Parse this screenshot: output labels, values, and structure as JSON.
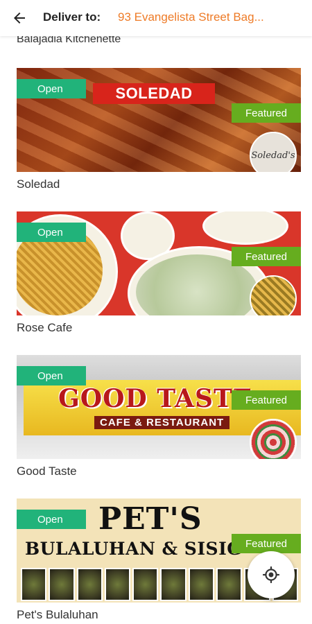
{
  "header": {
    "deliver_label": "Deliver to:",
    "address": "93 Evangelista Street Bag..."
  },
  "partial_item": {
    "name": "Balajadia Kitchenette"
  },
  "restaurants": [
    {
      "name": "Soledad",
      "status": "Open",
      "tag": "Featured",
      "banner_text": "SOLEDAD",
      "logo_text": "Soledad's"
    },
    {
      "name": "Rose Cafe",
      "status": "Open",
      "tag": "Featured"
    },
    {
      "name": "Good Taste",
      "status": "Open",
      "tag": "Featured",
      "sign_title": "GOOD TASTE",
      "sign_subtitle": "CAFE & RESTAURANT"
    },
    {
      "name": "Pet's Bulaluhan",
      "status": "Open",
      "tag": "Featured",
      "sign_title": "PET'S",
      "sign_subtitle": "BULALUHAN & SISIG"
    }
  ],
  "colors": {
    "accent": "#ee7b27",
    "open_badge": "#21b37a",
    "featured_badge": "#66ad1f"
  },
  "icons": {
    "back": "arrow-left-icon",
    "locate": "crosshair-icon"
  }
}
